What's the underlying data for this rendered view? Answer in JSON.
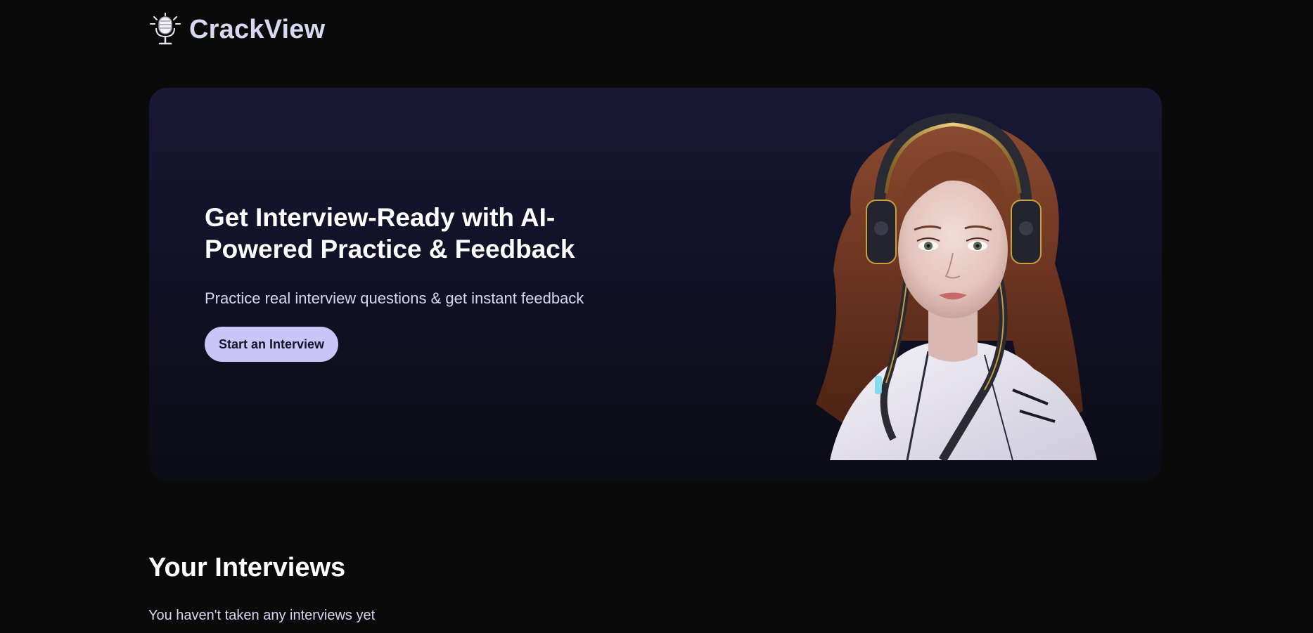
{
  "brand": {
    "name": "CrackView",
    "logo_icon": "microphone-icon"
  },
  "hero": {
    "title": "Get Interview-Ready with AI-Powered Practice & Feedback",
    "subtitle": "Practice real interview questions & get instant feedback",
    "cta_label": "Start an Interview"
  },
  "interviews": {
    "heading": "Your Interviews",
    "empty_message": "You haven't taken any interviews yet"
  },
  "colors": {
    "background": "#0a0a0b",
    "card_top": "#1a1836",
    "accent": "#cbc4f7",
    "logo_text": "#d8d8f2"
  }
}
